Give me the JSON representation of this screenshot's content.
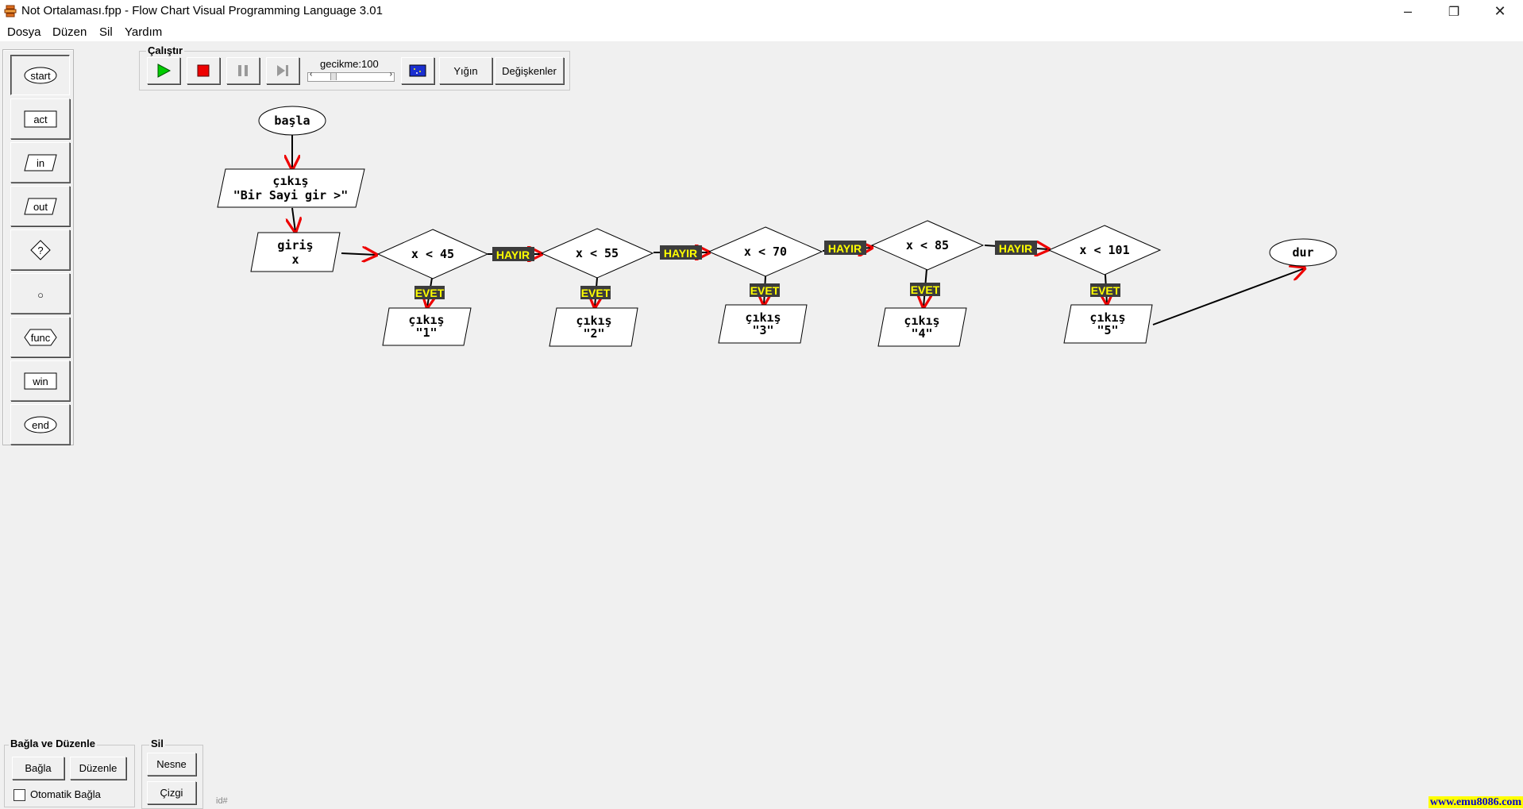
{
  "window": {
    "title": "Not Ortalaması.fpp - Flow Chart Visual Programming Language 3.01",
    "minimize": "–",
    "restore": "❐",
    "close": "✕"
  },
  "menu": [
    "Dosya",
    "Düzen",
    "Sil",
    "Yardım"
  ],
  "palette": [
    "start",
    "act",
    "in",
    "out",
    "?",
    "○",
    "func",
    "win",
    "end"
  ],
  "run": {
    "group_label": "Çalıştır",
    "delay_label": "gecikme:100",
    "stack_label": "Yığın",
    "variables_label": "Değişkenler",
    "play_color": "#00cc00",
    "stop_color": "#ee0000"
  },
  "flowchart": {
    "start": "başla",
    "output_prompt": [
      "çıkış",
      "\"Bir Sayi gir >\""
    ],
    "input": [
      "giriş",
      "x"
    ],
    "conditions": [
      "x < 45",
      "x < 55",
      "x < 70",
      "x < 85",
      "x < 101"
    ],
    "outputs": [
      [
        "çıkış",
        "\"1\""
      ],
      [
        "çıkış",
        "\"2\""
      ],
      [
        "çıkış",
        "\"3\""
      ],
      [
        "çıkış",
        "\"4\""
      ],
      [
        "çıkış",
        "\"5\""
      ]
    ],
    "end": "dur",
    "yes_label": "EVET",
    "no_label": "HAYIR"
  },
  "bottom": {
    "connect_group": "Bağla ve Düzenle",
    "connect_button": "Bağla",
    "arrange_button": "Düzenle",
    "auto_connect": "Otomatik Bağla",
    "delete_group": "Sil",
    "object_button": "Nesne",
    "line_button": "Çizgi",
    "id_label": "id#"
  },
  "watermark": "www.emu8086.com"
}
